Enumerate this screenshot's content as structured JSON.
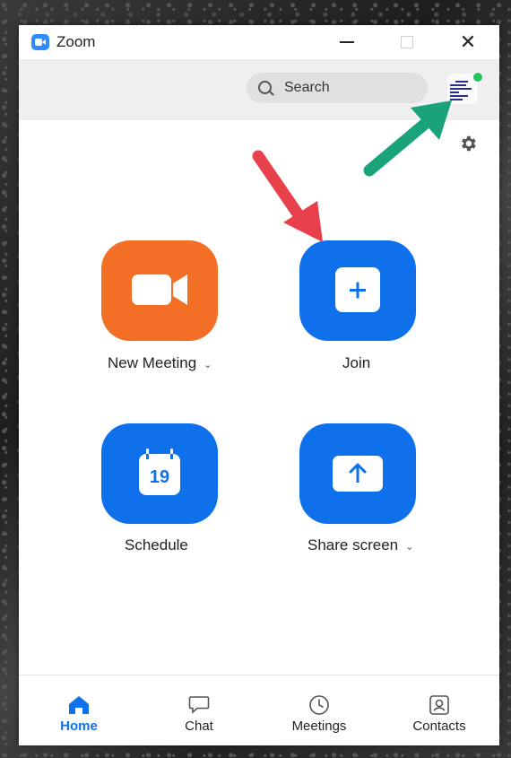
{
  "window": {
    "title": "Zoom"
  },
  "toolbar": {
    "search_label": "Search"
  },
  "actions": {
    "new_meeting": "New Meeting",
    "join": "Join",
    "schedule": "Schedule",
    "schedule_day": "19",
    "share_screen": "Share screen"
  },
  "nav": {
    "home": "Home",
    "chat": "Chat",
    "meetings": "Meetings",
    "contacts": "Contacts"
  },
  "colors": {
    "accent": "#0e71eb",
    "orange": "#f36f25",
    "status_green": "#21c45d",
    "annotation_red": "#e8414c",
    "annotation_green": "#1aa37a"
  },
  "icons": {
    "new_meeting": "video-camera-icon",
    "join": "plus-icon",
    "schedule": "calendar-icon",
    "share_screen": "upload-arrow-icon",
    "home": "home-icon",
    "chat": "chat-bubble-icon",
    "meetings": "clock-icon",
    "contacts": "contact-card-icon"
  }
}
